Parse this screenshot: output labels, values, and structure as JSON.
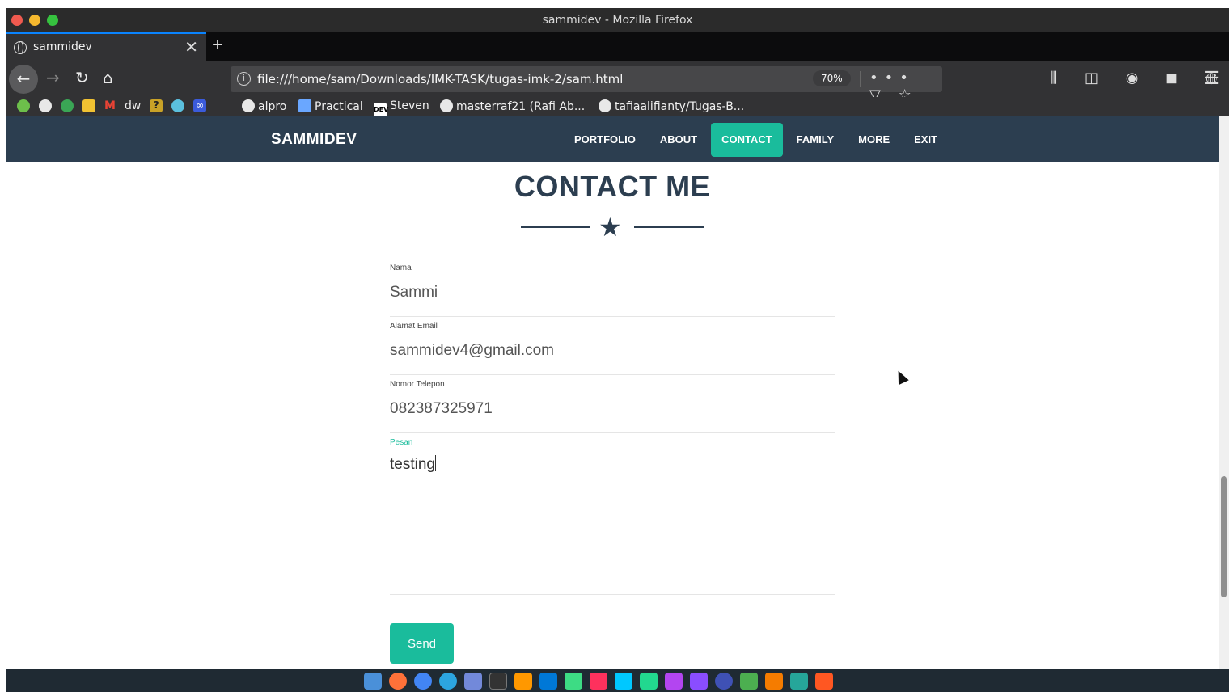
{
  "window": {
    "title": "sammidev - Mozilla Firefox"
  },
  "tab": {
    "label": "sammidev",
    "close": "✕",
    "new": "+"
  },
  "urlbar": {
    "url": "file:///home/sam/Downloads/IMK-TASK/tugas-imk-2/sam.html",
    "zoom": "70%",
    "actions": "••• ▽ ☆"
  },
  "bookmarks": [
    {
      "label": "alpro"
    },
    {
      "label": "Practical"
    },
    {
      "label": "Steven"
    },
    {
      "label": "masterraf21 (Rafi Ab..."
    },
    {
      "label": "tafiaalifianty/Tugas-B..."
    }
  ],
  "bookmark_icon_labels": {
    "m": "M",
    "dw": "dw",
    "q": "?",
    "oo": "∞",
    "dev": "DEV"
  },
  "site": {
    "brand": "SAMMIDEV",
    "menu": [
      "PORTFOLIO",
      "ABOUT",
      "CONTACT",
      "FAMILY",
      "MORE",
      "EXIT"
    ],
    "active_menu": "CONTACT",
    "heading": "CONTACT ME",
    "divider_icon": "star-icon"
  },
  "form": {
    "name_label": "Nama",
    "name_value": "Sammi",
    "email_label": "Alamat Email",
    "email_value": "sammidev4@gmail.com",
    "phone_label": "Nomor Telepon",
    "phone_value": "082387325971",
    "message_label": "Pesan",
    "message_value": "testing",
    "send_label": "Send"
  },
  "colors": {
    "navbar": "#2c3e50",
    "accent": "#1abc9c",
    "heading": "#2c3e50"
  }
}
